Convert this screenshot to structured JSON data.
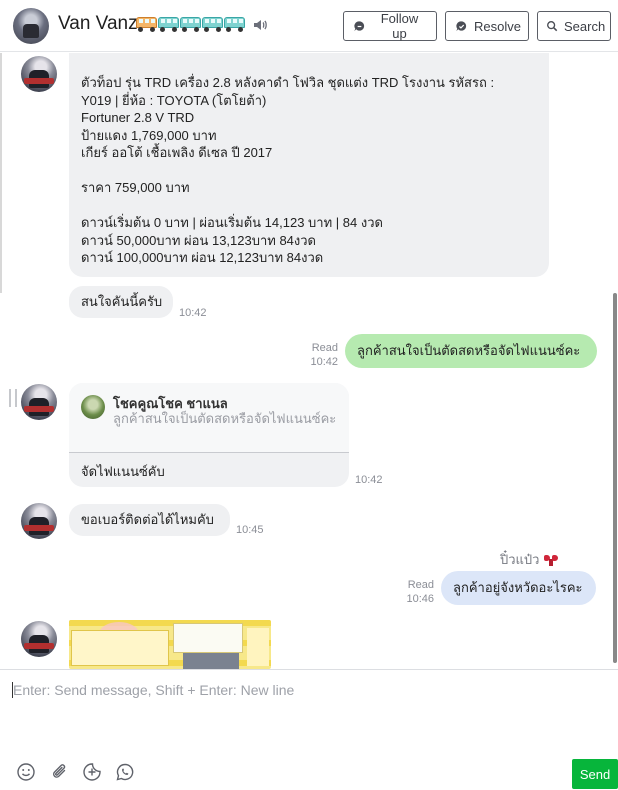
{
  "header": {
    "contact_name": "Van Vanz",
    "name_emoji": [
      "bus-emoji",
      "bus-emoji",
      "bus-emoji",
      "bus-emoji",
      "bus-emoji"
    ],
    "buttons": {
      "follow_up": "Follow up",
      "resolve": "Resolve",
      "search": "Search"
    }
  },
  "messages": {
    "listing": {
      "lines": [
        "ตัวท็อป รุ่น TRD เครื่อง 2.8 หลังคาดำ โฟวิล ชุดแต่ง TRD โรงงาน  รหัสรถ :",
        "Y019 |  ยี่ห้อ : TOYOTA (โตโยต้า)",
        "Fortuner 2.8 V TRD",
        " ป้ายแดง 1,769,000 บาท",
        " เกียร์ ออโต้   เชื้อเพลิง ดีเซล   ปี  2017",
        "",
        "ราคา 759,000 บาท",
        "",
        "ดาวน์เริ่มต้น 0 บาท | ผ่อนเริ่มต้น 14,123  บาท | 84 งวด",
        "ดาวน์ 50,000บาท ผ่อน 13,123บาท 84งวด",
        "ดาวน์ 100,000บาท ผ่อน 12,123บาท 84งวด"
      ]
    },
    "interest": {
      "text": "สนใจคันนี้ครับ",
      "time": "10:42"
    },
    "agent_question": {
      "read": "Read",
      "time": "10:42",
      "text": "ลูกค้าสนใจเป็นตัดสดหรือจัดไฟแนนซ์คะ"
    },
    "reply": {
      "quoted_name": "โชคคูณโชค ชาแนล",
      "quoted_text": "ลูกค้าสนใจเป็นตัดสดหรือจัดไฟแนนซ์คะ",
      "text": "จัดไฟแนนซ์คับ",
      "time": "10:42"
    },
    "ask_number": {
      "text": "ขอเบอร์ติดต่อได้ไหมคับ",
      "time": "10:45"
    },
    "agent_name": "ปิ๋วแป๋ว",
    "agent_province": {
      "read": "Read",
      "time": "10:46",
      "text": "ลูกค้าอยู่จังหวัดอะไรคะ"
    }
  },
  "composer": {
    "placeholder": "Enter: Send message, Shift + Enter: New line",
    "send_label": "Send",
    "tools": [
      "emoji-icon",
      "attachment-icon",
      "sticker-add-icon",
      "line-chat-icon"
    ]
  },
  "colors": {
    "send_button": "#07b53b",
    "outgoing_green": "#b6eab0",
    "outgoing_blue": "#dce6f8",
    "incoming": "#eff0f2"
  }
}
